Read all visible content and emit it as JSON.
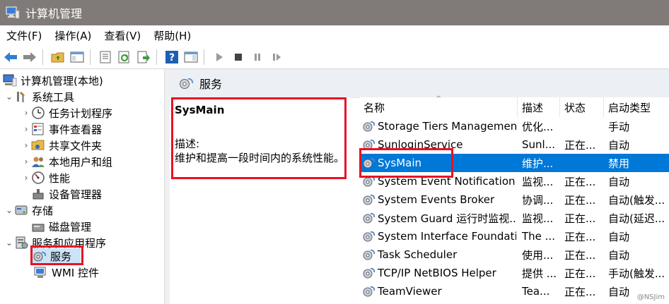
{
  "window": {
    "title": "计算机管理"
  },
  "menu": [
    "文件(F)",
    "操作(A)",
    "查看(V)",
    "帮助(H)"
  ],
  "toolbar": {
    "icons": [
      "back-arrow-icon",
      "forward-arrow-icon",
      "up-folder-icon",
      "show-hide-tree-icon",
      "properties-icon",
      "refresh-icon",
      "export-list-icon",
      "help-icon",
      "show-action-pane-icon",
      "start-service-icon",
      "stop-service-icon",
      "pause-service-icon",
      "resume-service-icon"
    ]
  },
  "tree": {
    "root": "计算机管理(本地)",
    "system_tools": "系统工具",
    "task_scheduler": "任务计划程序",
    "event_viewer": "事件查看器",
    "shared_folders": "共享文件夹",
    "local_users": "本地用户和组",
    "performance": "性能",
    "device_manager": "设备管理器",
    "storage": "存储",
    "disk_management": "磁盘管理",
    "services_apps": "服务和应用程序",
    "services": "服务",
    "wmi": "WMI 控件"
  },
  "header": {
    "title": "服务"
  },
  "description": {
    "service_name": "SysMain",
    "label": "描述:",
    "text": "维护和提高一段时间内的系统性能。"
  },
  "columns": {
    "name": "名称",
    "desc": "描述",
    "status": "状态",
    "startup": "启动类型"
  },
  "services": [
    {
      "name": "Storage Tiers Management",
      "desc": "优化...",
      "status": "",
      "startup": "手动"
    },
    {
      "name": "SunloginService",
      "desc": "Sunl...",
      "status": "正在...",
      "startup": "自动"
    },
    {
      "name": "SysMain",
      "desc": "维护...",
      "status": "",
      "startup": "禁用"
    },
    {
      "name": "System Event Notification ...",
      "desc": "监视...",
      "status": "正在...",
      "startup": "自动"
    },
    {
      "name": "System Events Broker",
      "desc": "协调...",
      "status": "正在...",
      "startup": "自动(触发..."
    },
    {
      "name": "System Guard 运行时监视...",
      "desc": "监视...",
      "status": "正在...",
      "startup": "自动(延迟..."
    },
    {
      "name": "System Interface Foundati...",
      "desc": "The ...",
      "status": "正在...",
      "startup": "自动"
    },
    {
      "name": "Task Scheduler",
      "desc": "使用...",
      "status": "正在...",
      "startup": "自动"
    },
    {
      "name": "TCP/IP NetBIOS Helper",
      "desc": "提供 ...",
      "status": "正在...",
      "startup": "手动(触发..."
    },
    {
      "name": "TeamViewer",
      "desc": "Tea...",
      "status": "正在...",
      "startup": "自动"
    }
  ],
  "watermark": "@NSJim",
  "colors": {
    "titlebar": "#807b78",
    "selection": "#0078d7",
    "highlight_box": "#e81123",
    "header_strip": "#eceff4"
  }
}
